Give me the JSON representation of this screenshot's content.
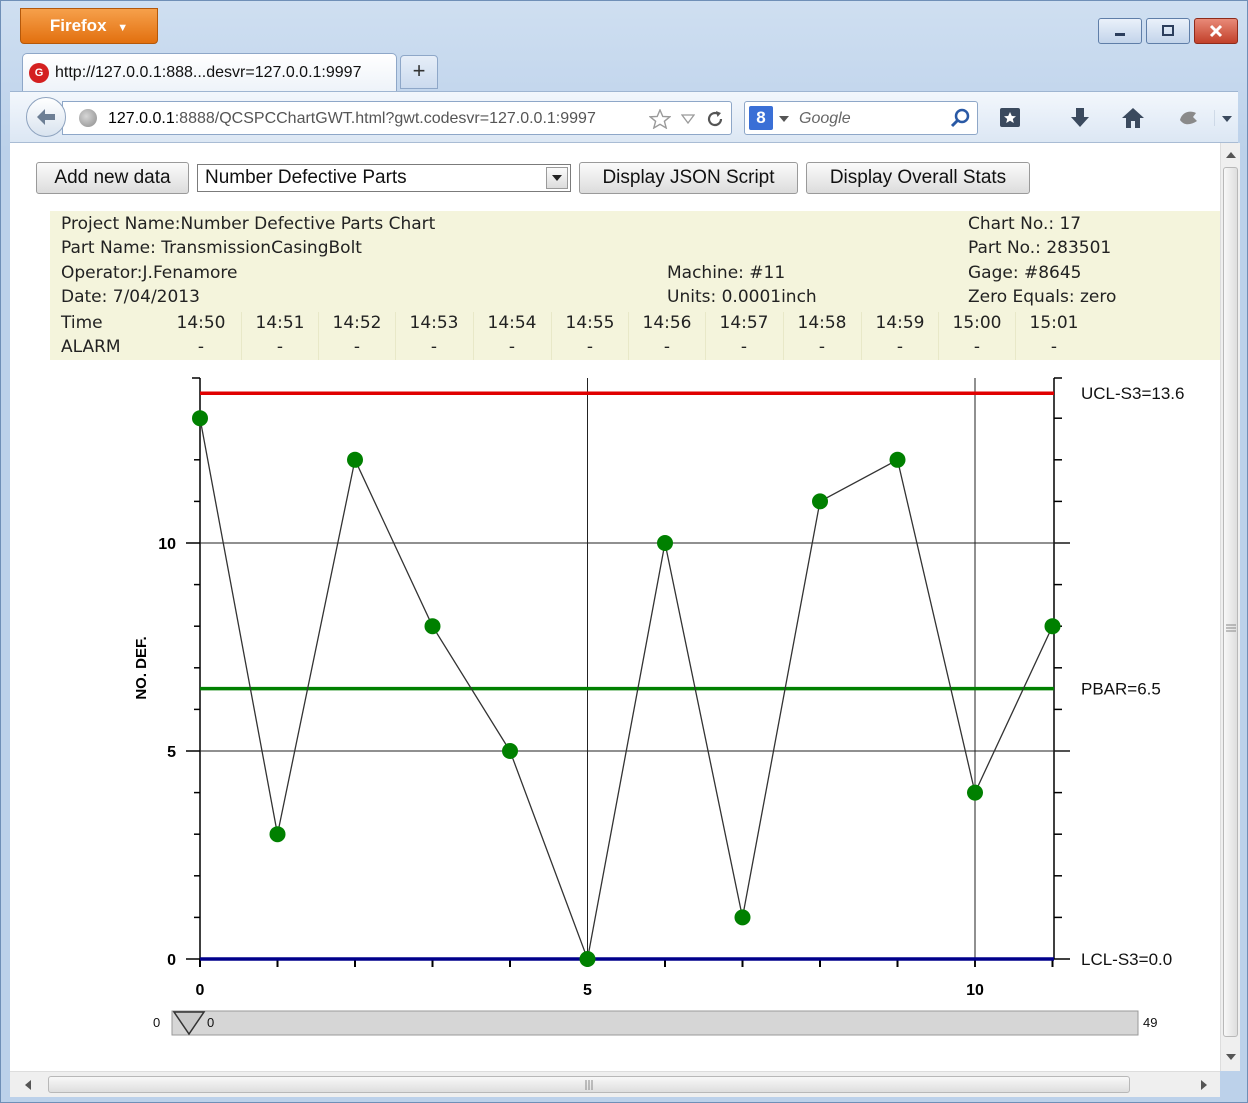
{
  "browser": {
    "menu_label": "Firefox",
    "tab_title": "http://127.0.0.1:888...desvr=127.0.0.1:9997",
    "url_host": "127.0.0.1",
    "url_rest": ":8888/QCSPCChartGWT.html?gwt.codesvr=127.0.0.1:9997",
    "search_placeholder": "Google"
  },
  "toolbar": {
    "add_label": "Add new data",
    "select_value": "Number Defective Parts",
    "json_label": "Display JSON Script",
    "stats_label": "Display Overall Stats"
  },
  "header": {
    "project": "Project Name:Number Defective Parts Chart",
    "part_name": "Part Name: TransmissionCasingBolt",
    "operator": "Operator:J.Fenamore",
    "date": "Date: 7/04/2013",
    "machine": "Machine: #11",
    "units": "Units: 0.0001inch",
    "chart_no": "Chart No.: 17",
    "part_no": "Part No.: 283501",
    "gage": "Gage: #8645",
    "zero": "Zero Equals: zero",
    "time_label": "Time",
    "alarm_label": "ALARM",
    "times": [
      "14:50",
      "14:51",
      "14:52",
      "14:53",
      "14:54",
      "14:55",
      "14:56",
      "14:57",
      "14:58",
      "14:59",
      "15:00",
      "15:01"
    ],
    "alarms": [
      "-",
      "-",
      "-",
      "-",
      "-",
      "-",
      "-",
      "-",
      "-",
      "-",
      "-",
      "-"
    ]
  },
  "chart_data": {
    "type": "line",
    "ylabel": "NO. DEF.",
    "x": [
      0,
      1,
      2,
      3,
      4,
      5,
      6,
      7,
      8,
      9,
      10,
      11
    ],
    "values": [
      13,
      3,
      12,
      8,
      5,
      0,
      10,
      1,
      11,
      12,
      4,
      8
    ],
    "xlim": [
      0,
      11
    ],
    "ylim": [
      0,
      14
    ],
    "x_ticks": [
      0,
      5,
      10
    ],
    "y_ticks": [
      0,
      5,
      10
    ],
    "limits": [
      {
        "label": "UCL-S3=13.6",
        "value": 13.6,
        "color": "#e00000"
      },
      {
        "label": "PBAR=6.5",
        "value": 6.5,
        "color": "#008000"
      },
      {
        "label": "LCL-S3=0.0",
        "value": 0.0,
        "color": "#00008b"
      }
    ],
    "point_color": "#008000",
    "line_color": "#333333",
    "grid": true
  },
  "slider": {
    "min_label": "0",
    "value_label": "0",
    "max_label": "49"
  }
}
